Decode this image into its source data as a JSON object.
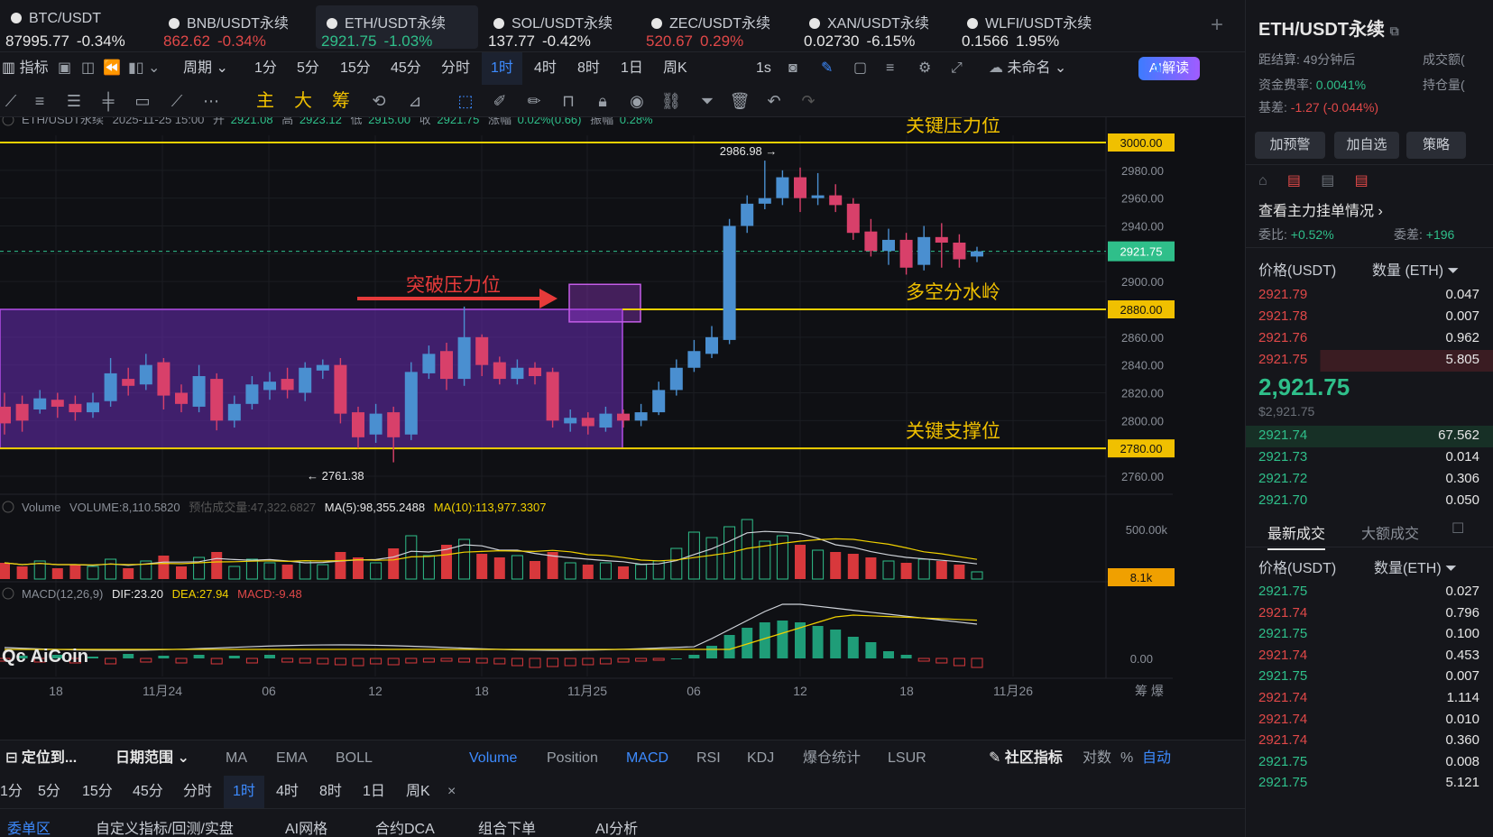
{
  "tickers": [
    {
      "name": "BTC/USDT",
      "price": "87995.77",
      "change": "-0.34%",
      "color": "#e6e6e6"
    },
    {
      "name": "BNB/USDT永续",
      "price": "862.62",
      "change": "-0.34%",
      "color": "#e04848"
    },
    {
      "name": "ETH/USDT永续",
      "price": "2921.75",
      "change": "-1.03%",
      "color": "#2fbf8a"
    },
    {
      "name": "SOL/USDT永续",
      "price": "137.77",
      "change": "-0.42%",
      "color": "#e6e6e6"
    },
    {
      "name": "ZEC/USDT永续",
      "price": "520.67",
      "change": "0.29%",
      "color": "#e04848"
    },
    {
      "name": "XAN/USDT永续",
      "price": "0.02730",
      "change": "-6.15%",
      "color": "#e6e6e6"
    },
    {
      "name": "WLFI/USDT永续",
      "price": "0.1566",
      "change": "1.95%",
      "color": "#e6e6e6"
    }
  ],
  "toolbar1": {
    "indicator": "指标",
    "period": "周期",
    "intervals": [
      "1分",
      "5分",
      "15分",
      "45分",
      "分时",
      "1时",
      "4时",
      "8时",
      "1日",
      "周K"
    ],
    "active_interval": "1时",
    "seconds": "1s",
    "layout_name": "未命名",
    "ai_label": "AI解读"
  },
  "toolbar2": {
    "main": "主",
    "big": "大",
    "chips": "筹"
  },
  "chart_info": {
    "symbol": "ETH/USDT永续",
    "datetime": "2025-11-25 15:00",
    "open_label": "开",
    "open": "2921.08",
    "high_label": "高",
    "high": "2923.12",
    "low_label": "低",
    "low": "2915.00",
    "close_label": "收",
    "close": "2921.75",
    "change_label": "涨幅",
    "change": "0.02%(0.66)",
    "amp_label": "振幅",
    "amp": "0.28%"
  },
  "volume_info": {
    "label": "Volume",
    "volume": "VOLUME:8,110.5820",
    "est": "预估成交量:47,322.6827",
    "ma5": "MA(5):98,355.2488",
    "ma10": "MA(10):113,977.3307"
  },
  "macd_info": {
    "label": "MACD(12,26,9)",
    "dif": "DIF:23.20",
    "dea": "DEA:27.94",
    "macd": "MACD:-9.48"
  },
  "logo_text": "AiCoin",
  "chart_data": {
    "type": "candlestick",
    "symbol": "ETH/USDT永续",
    "interval": "1时",
    "ylim": [
      2740,
      3000
    ],
    "y_ticks": [
      2760,
      2780,
      2800,
      2820,
      2840,
      2860,
      2880,
      2900,
      2920,
      2940,
      2960,
      2980,
      3000
    ],
    "y_tick_labels": [
      "2760.00",
      "2800.00",
      "2820.00",
      "2840.00",
      "2860.00",
      "2900.00",
      "2940.00",
      "2960.00",
      "2980.00"
    ],
    "x_tick_labels": [
      "18",
      "11月24",
      "06",
      "12",
      "18",
      "11月25",
      "06",
      "12",
      "18",
      "11月26"
    ],
    "candles": [
      [
        2810,
        2798,
        2820,
        2790
      ],
      [
        2812,
        2800,
        2818,
        2792
      ],
      [
        2808,
        2816,
        2822,
        2805
      ],
      [
        2815,
        2810,
        2820,
        2802
      ],
      [
        2812,
        2806,
        2818,
        2800
      ],
      [
        2806,
        2813,
        2820,
        2802
      ],
      [
        2814,
        2834,
        2845,
        2810
      ],
      [
        2830,
        2825,
        2838,
        2818
      ],
      [
        2826,
        2840,
        2848,
        2822
      ],
      [
        2842,
        2818,
        2845,
        2808
      ],
      [
        2820,
        2812,
        2826,
        2806
      ],
      [
        2810,
        2832,
        2840,
        2806
      ],
      [
        2830,
        2800,
        2834,
        2793
      ],
      [
        2800,
        2812,
        2818,
        2795
      ],
      [
        2812,
        2826,
        2832,
        2808
      ],
      [
        2822,
        2828,
        2835,
        2815
      ],
      [
        2830,
        2822,
        2838,
        2816
      ],
      [
        2820,
        2838,
        2842,
        2814
      ],
      [
        2836,
        2840,
        2844,
        2830
      ],
      [
        2840,
        2805,
        2845,
        2798
      ],
      [
        2806,
        2788,
        2810,
        2780
      ],
      [
        2790,
        2805,
        2812,
        2784
      ],
      [
        2806,
        2788,
        2810,
        2770
      ],
      [
        2790,
        2835,
        2842,
        2786
      ],
      [
        2834,
        2848,
        2854,
        2830
      ],
      [
        2850,
        2830,
        2856,
        2822
      ],
      [
        2830,
        2860,
        2882,
        2825
      ],
      [
        2860,
        2840,
        2862,
        2832
      ],
      [
        2842,
        2830,
        2846,
        2826
      ],
      [
        2830,
        2838,
        2844,
        2826
      ],
      [
        2838,
        2832,
        2842,
        2826
      ],
      [
        2835,
        2800,
        2838,
        2795
      ],
      [
        2798,
        2802,
        2808,
        2792
      ],
      [
        2802,
        2796,
        2806,
        2790
      ],
      [
        2795,
        2805,
        2810,
        2792
      ],
      [
        2805,
        2800,
        2808,
        2795
      ],
      [
        2800,
        2806,
        2812,
        2796
      ],
      [
        2806,
        2822,
        2828,
        2804
      ],
      [
        2822,
        2838,
        2844,
        2818
      ],
      [
        2838,
        2850,
        2858,
        2835
      ],
      [
        2848,
        2860,
        2868,
        2845
      ],
      [
        2858,
        2940,
        2945,
        2855
      ],
      [
        2940,
        2956,
        2962,
        2935
      ],
      [
        2956,
        2960,
        2986.98,
        2952
      ],
      [
        2960,
        2975,
        2980,
        2955
      ],
      [
        2975,
        2960,
        2982,
        2950
      ],
      [
        2960,
        2962,
        2978,
        2955
      ],
      [
        2962,
        2955,
        2970,
        2950
      ],
      [
        2956,
        2935,
        2960,
        2930
      ],
      [
        2936,
        2922,
        2945,
        2918
      ],
      [
        2922,
        2930,
        2938,
        2912
      ],
      [
        2930,
        2910,
        2935,
        2905
      ],
      [
        2912,
        2932,
        2940,
        2908
      ],
      [
        2932,
        2928,
        2942,
        2910
      ],
      [
        2928,
        2916,
        2934,
        2910
      ],
      [
        2918,
        2921.75,
        2925,
        2914
      ]
    ],
    "low_marker": "2761.38",
    "high_marker": "2986.98",
    "last_price": "2921.75",
    "level_lines": [
      {
        "price": 3000,
        "price_label": "3000.00",
        "label": "关键压力位"
      },
      {
        "price": 2880,
        "price_label": "2880.00",
        "label": "多空分水岭"
      },
      {
        "price": 2780,
        "price_label": "2780.00",
        "label": "关键支撑位"
      }
    ],
    "annotation": "突破压力位",
    "volume_tick_label": "500.00k",
    "volume_last_label": "8.1k",
    "macd_tick_label": "0.00"
  },
  "indicator_bar": {
    "locate": "定位到...",
    "date_range": "日期范围",
    "main_inds": [
      "MA",
      "EMA",
      "BOLL"
    ],
    "sub_inds": [
      "Volume",
      "Position",
      "MACD",
      "RSI",
      "KDJ",
      "爆仓统计",
      "LSUR"
    ],
    "community": "社区指标",
    "log": "对数",
    "percent": "%",
    "auto": "自动"
  },
  "interval_bar": {
    "items": [
      "1分",
      "5分",
      "15分",
      "45分",
      "分时",
      "1时",
      "4时",
      "8时",
      "1日",
      "周K"
    ],
    "active": "1时",
    "close": "×"
  },
  "bottom_tabs": [
    "委单区",
    "自定义指标/回测/实盘",
    "AI网格",
    "合约DCA",
    "组合下单",
    "AI分析"
  ],
  "right_panel": {
    "title": "ETH/USDT永续",
    "settle_label": "距结算:",
    "settle": "49分钟后",
    "vol_label": "成交额(",
    "fund_label": "资金费率:",
    "fund": "0.0041%",
    "oi_label": "持仓量(",
    "basis_label": "基差:",
    "basis": "-1.27 (-0.044%)",
    "buttons": [
      "加预警",
      "加自选",
      "策略"
    ],
    "depth_link": "查看主力挂单情况",
    "ratio_label": "委比:",
    "ratio": "+0.52%",
    "diff_label": "委差:",
    "diff": "+196",
    "ob_price_head": "价格(USDT)",
    "ob_qty_head": "数量 (ETH)",
    "asks": [
      [
        "2921.79",
        "0.047"
      ],
      [
        "2921.78",
        "0.007"
      ],
      [
        "2921.76",
        "0.962"
      ],
      [
        "2921.75",
        "5.805"
      ]
    ],
    "mid": "2,921.75",
    "mid_usd": "$2,921.75",
    "bids": [
      [
        "2921.74",
        "67.562"
      ],
      [
        "2921.73",
        "0.014"
      ],
      [
        "2921.72",
        "0.306"
      ],
      [
        "2921.70",
        "0.050"
      ]
    ],
    "trade_tabs": [
      "最新成交",
      "大额成交"
    ],
    "trade_price_head": "价格(USDT)",
    "trade_qty_head": "数量(ETH)",
    "trades": [
      [
        "2921.75",
        "0.027",
        "g"
      ],
      [
        "2921.74",
        "0.796",
        "r"
      ],
      [
        "2921.75",
        "0.100",
        "g"
      ],
      [
        "2921.74",
        "0.453",
        "r"
      ],
      [
        "2921.75",
        "0.007",
        "g"
      ],
      [
        "2921.74",
        "1.114",
        "r"
      ],
      [
        "2921.74",
        "0.010",
        "r"
      ],
      [
        "2921.74",
        "0.360",
        "r"
      ],
      [
        "2921.75",
        "0.008",
        "g"
      ],
      [
        "2921.75",
        "5.121",
        "g"
      ]
    ]
  }
}
